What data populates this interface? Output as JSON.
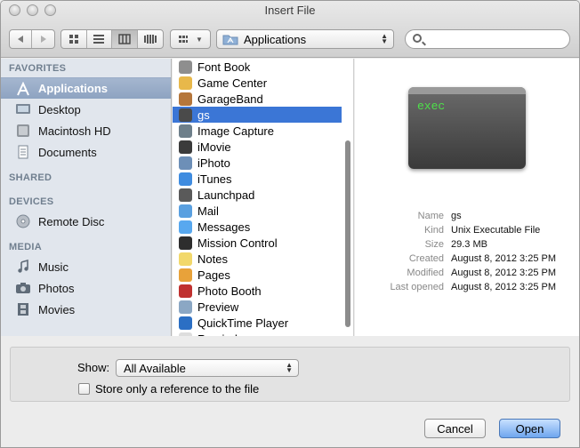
{
  "window": {
    "title": "Insert File"
  },
  "toolbar": {
    "view_modes": [
      "icon-view",
      "list-view",
      "column-view",
      "coverflow-view"
    ],
    "active_view": "column-view",
    "location": "Applications",
    "search_placeholder": ""
  },
  "sidebar": {
    "sections": [
      {
        "heading": "FAVORITES",
        "items": [
          {
            "label": "Applications",
            "icon": "applications-icon",
            "selected": true
          },
          {
            "label": "Desktop",
            "icon": "desktop-icon",
            "selected": false
          },
          {
            "label": "Macintosh HD",
            "icon": "hard-drive-icon",
            "selected": false
          },
          {
            "label": "Documents",
            "icon": "documents-icon",
            "selected": false
          }
        ]
      },
      {
        "heading": "SHARED",
        "items": []
      },
      {
        "heading": "DEVICES",
        "items": [
          {
            "label": "Remote Disc",
            "icon": "disc-icon",
            "selected": false
          }
        ]
      },
      {
        "heading": "MEDIA",
        "items": [
          {
            "label": "Music",
            "icon": "music-icon",
            "selected": false
          },
          {
            "label": "Photos",
            "icon": "camera-icon",
            "selected": false
          },
          {
            "label": "Movies",
            "icon": "film-icon",
            "selected": false
          }
        ]
      }
    ]
  },
  "files": [
    {
      "name": "Font Book",
      "icon": "font-book-icon",
      "color": "#8e8e8e"
    },
    {
      "name": "Game Center",
      "icon": "game-center-icon",
      "color": "#e8b84a"
    },
    {
      "name": "GarageBand",
      "icon": "garageband-icon",
      "color": "#b5763a"
    },
    {
      "name": "gs",
      "icon": "exec-icon",
      "color": "#4a4a4a",
      "selected": true
    },
    {
      "name": "Image Capture",
      "icon": "image-capture-icon",
      "color": "#6e7f8a"
    },
    {
      "name": "iMovie",
      "icon": "imovie-icon",
      "color": "#3b3b3b"
    },
    {
      "name": "iPhoto",
      "icon": "iphoto-icon",
      "color": "#6d8fb7"
    },
    {
      "name": "iTunes",
      "icon": "itunes-icon",
      "color": "#3f8ce0"
    },
    {
      "name": "Launchpad",
      "icon": "launchpad-icon",
      "color": "#5a5a5a"
    },
    {
      "name": "Mail",
      "icon": "mail-icon",
      "color": "#5aa0e0"
    },
    {
      "name": "Messages",
      "icon": "messages-icon",
      "color": "#58a8ef"
    },
    {
      "name": "Mission Control",
      "icon": "mission-control-icon",
      "color": "#2e2e2e"
    },
    {
      "name": "Notes",
      "icon": "notes-icon",
      "color": "#f2d86b"
    },
    {
      "name": "Pages",
      "icon": "pages-icon",
      "color": "#e8a23a"
    },
    {
      "name": "Photo Booth",
      "icon": "photo-booth-icon",
      "color": "#c0312f"
    },
    {
      "name": "Preview",
      "icon": "preview-icon",
      "color": "#8ba7c4"
    },
    {
      "name": "QuickTime Player",
      "icon": "quicktime-icon",
      "color": "#2b6fc4"
    },
    {
      "name": "Reminders",
      "icon": "reminders-icon",
      "color": "#dddddd"
    }
  ],
  "preview": {
    "icon_text": "exec",
    "rows": [
      {
        "key": "Name",
        "value": "gs"
      },
      {
        "key": "Kind",
        "value": "Unix Executable File"
      },
      {
        "key": "Size",
        "value": "29.3 MB"
      },
      {
        "key": "Created",
        "value": "August 8, 2012 3:25 PM"
      },
      {
        "key": "Modified",
        "value": "August 8, 2012 3:25 PM"
      },
      {
        "key": "Last opened",
        "value": "August 8, 2012 3:25 PM"
      }
    ]
  },
  "options": {
    "show_label": "Show:",
    "show_value": "All Available",
    "checkbox_label": "Store only a reference to the file",
    "checkbox_checked": false
  },
  "buttons": {
    "cancel": "Cancel",
    "open": "Open"
  }
}
